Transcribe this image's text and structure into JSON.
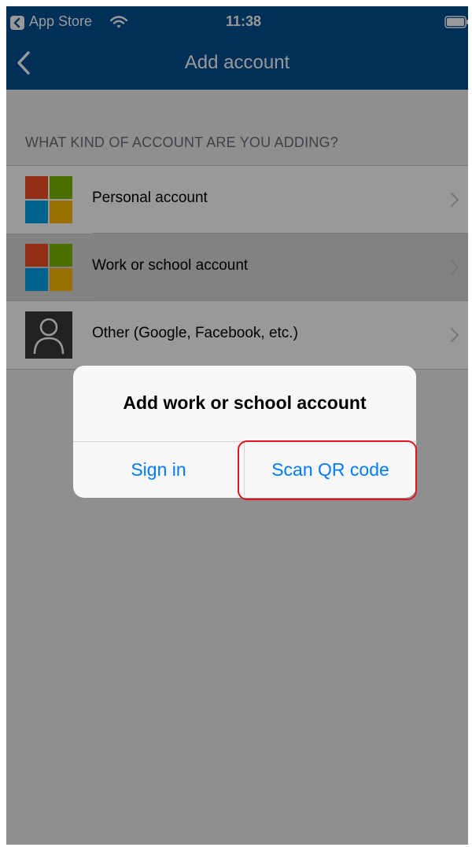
{
  "status_bar": {
    "back_app": "App Store",
    "time": "11:38"
  },
  "nav": {
    "title": "Add account"
  },
  "section": {
    "header": "WHAT KIND OF ACCOUNT ARE YOU ADDING?"
  },
  "accounts": [
    {
      "label": "Personal account",
      "icon": "microsoft-logo-icon"
    },
    {
      "label": "Work or school account",
      "icon": "microsoft-logo-icon",
      "highlighted": true
    },
    {
      "label": "Other (Google, Facebook, etc.)",
      "icon": "person-icon"
    }
  ],
  "alert": {
    "title": "Add work or school account",
    "buttons": [
      "Sign in",
      "Scan QR code"
    ]
  },
  "colors": {
    "nav_blue": "#004f91",
    "ios_blue": "#007aff",
    "ms_red": "#f25022",
    "ms_green": "#7fba00",
    "ms_blue": "#00a4ef",
    "ms_yellow": "#ffb900",
    "annotation_red": "#e0141e"
  }
}
